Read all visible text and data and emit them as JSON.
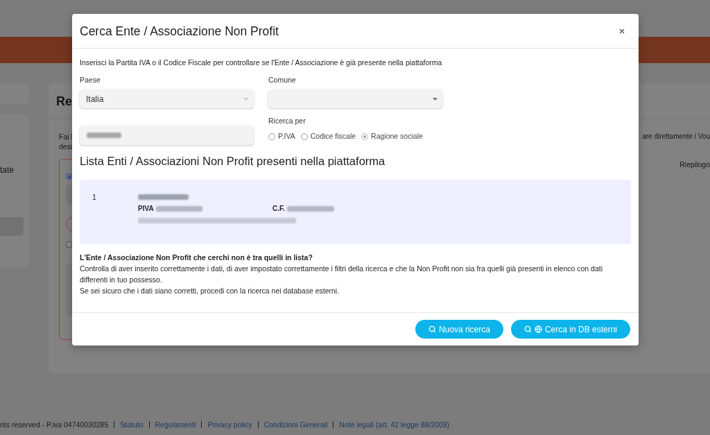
{
  "page": {
    "left_panel": {
      "label": "tate"
    },
    "main_card": {
      "heading": "Re",
      "intro_lines": [
        "Fai l",
        "desi"
      ],
      "right_text": "are direttamente i Vou",
      "summary_label": "Riepilogo",
      "choice": {
        "selected": true
      },
      "checkbox": {
        "checked": false
      }
    },
    "footer": {
      "text": "nts reserved - P.iva 04740030285",
      "links": [
        "Statuto",
        "Regolamenti",
        "Privacy policy",
        "Condizioni Generali",
        "Note legali (art. 42 legge 88/2009)"
      ]
    }
  },
  "dialog": {
    "title": "Cerca Ente / Associazione Non Profit",
    "instructions": "Inserisci la Partita IVA o il Codice Fiscale per controllare se l'Ente / Associazione è già presente nella piattaforma",
    "country": {
      "label": "Paese",
      "value": "Italia"
    },
    "municipality": {
      "label": "Comune"
    },
    "name_field": {
      "redacted": true
    },
    "search_by": {
      "label": "Ricerca per",
      "options": [
        {
          "label": "P.IVA",
          "selected": false
        },
        {
          "label": "Codice fiscale",
          "selected": false
        },
        {
          "label": "Ragione sociale",
          "selected": true
        }
      ]
    },
    "list_title": "Lista Enti / Associazioni Non Profit presenti nella piattaforma",
    "results": [
      {
        "index": "1",
        "vat_label": "PIVA",
        "tax_code_label": "C.F.",
        "redacted": true
      }
    ],
    "help": {
      "question": "L'Ente / Associazione Non Profit che cerchi non è tra quelli in lista?",
      "paragraphs": [
        "Controlla di aver inserito correttamente i dati, di aver impostato correttamente i filtri della ricerca e che la Non Profit non sia fra quelli già presenti in elenco con dati differenti in tuo possesso.",
        "Se sei sicuro che i dati siano corretti, procedi con la ricerca nei database esterni."
      ]
    },
    "buttons": [
      {
        "label": "Nuova ricerca",
        "kind": "search"
      },
      {
        "label": "Cerca in DB esterni",
        "kind": "external"
      }
    ]
  }
}
